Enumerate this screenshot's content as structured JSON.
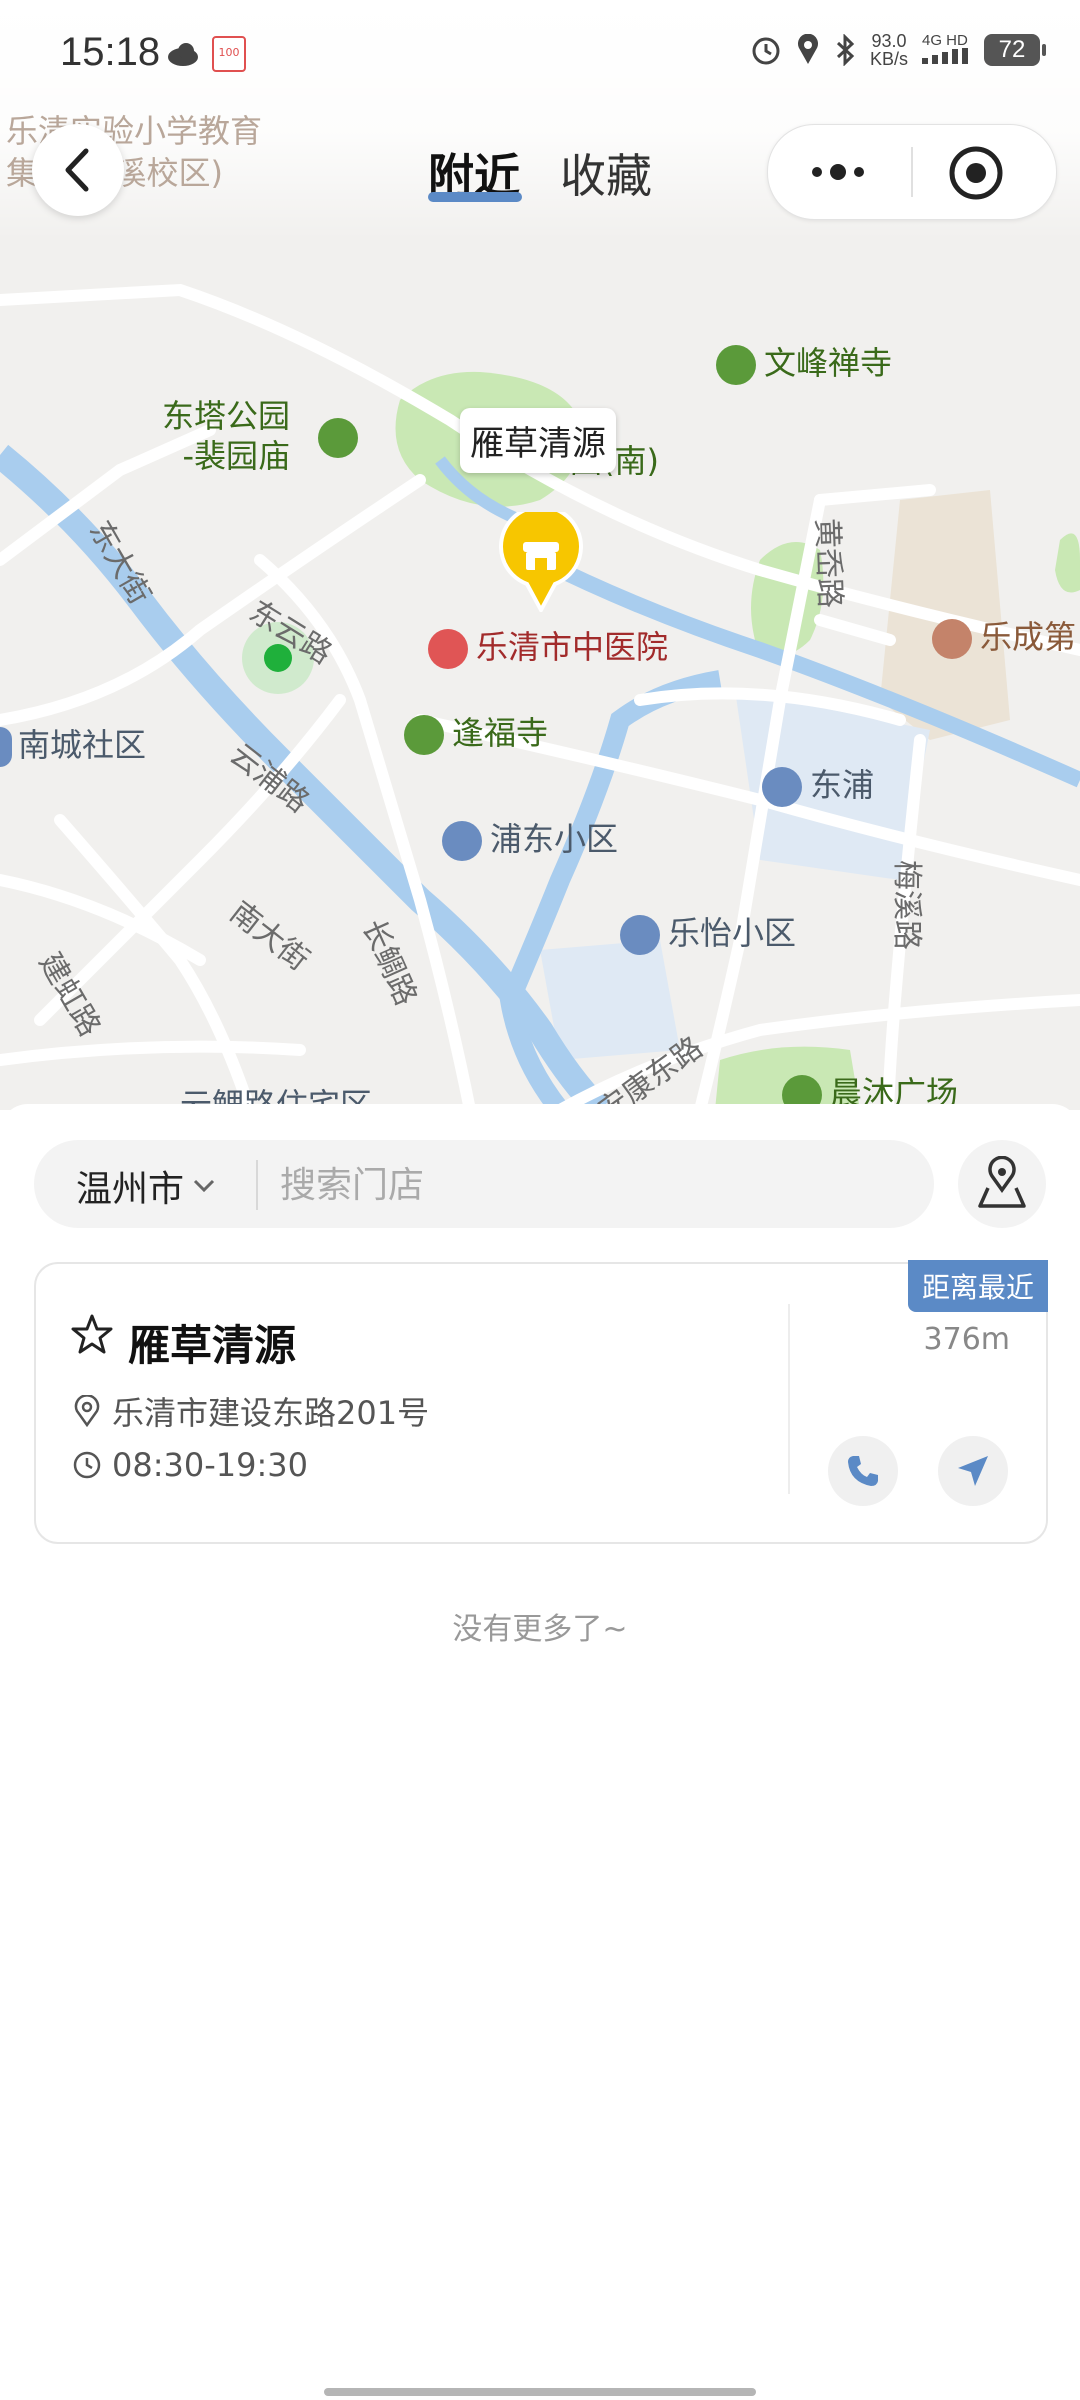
{
  "status_bar": {
    "time": "15:18",
    "speed_value": "93.0",
    "speed_unit": "KB/s",
    "network_top": "4G HD",
    "battery": "72",
    "calendar_text": "100"
  },
  "nav": {
    "tab_nearby": "附近",
    "tab_favorites": "收藏"
  },
  "map": {
    "faded_top_line1": "乐清实验小学教育",
    "faded_top_line2": "集团(滨溪校区)",
    "pin_label": "雁草清源",
    "poi_wenfeng": "文峰禅寺",
    "poi_dongta_1": "东塔公园",
    "poi_dongta_2": "-裴园庙",
    "poi_park_south": "园(南)",
    "poi_hospital": "乐清市中医院",
    "poi_fengfu": "逢福寺",
    "poi_nancheng": "南城社区",
    "poi_pudong": "浦东小区",
    "poi_dongpu": "东浦",
    "poi_leyi": "乐怡小区",
    "poi_lecheng": "乐成第",
    "poi_chenmu": "晨沐广场",
    "poi_yunli": "云鲤路住宅区",
    "street_dongda": "东大街",
    "street_dongyun": "东云路",
    "street_yunpu": "云浦路",
    "street_nanda": "南大街",
    "street_jianhong": "建虹路",
    "street_chuanbang": "长鲷路",
    "street_huangxian": "黄岙路",
    "street_meixi": "梅溪路",
    "street_ankang": "安康东路"
  },
  "search": {
    "city": "温州市",
    "placeholder": "搜索门店"
  },
  "store": {
    "badge": "距离最近",
    "name": "雁草清源",
    "address": "乐清市建设东路201号",
    "hours": "08:30-19:30",
    "distance": "376m"
  },
  "footer": {
    "no_more": "没有更多了~"
  },
  "colors": {
    "accent_blue": "#5b8ac6",
    "pin_yellow": "#f7c600",
    "water": "#a9cdee",
    "park_green": "#c9e8b4"
  }
}
